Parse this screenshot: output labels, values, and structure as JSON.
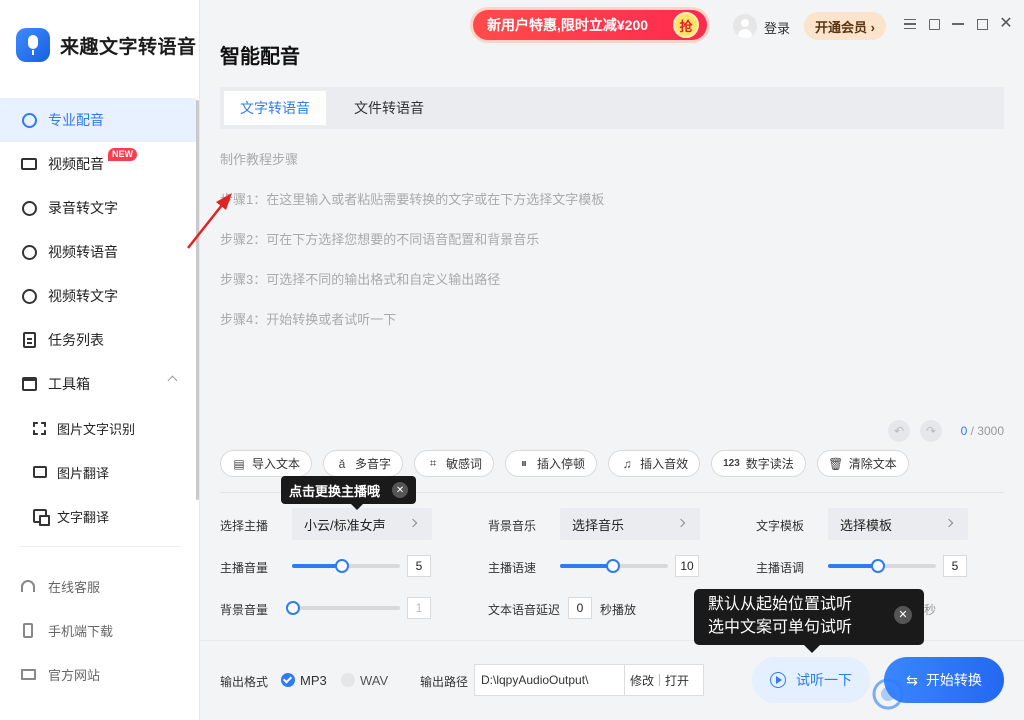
{
  "app": {
    "name": "来趣文字转语音"
  },
  "sidebar": {
    "items": [
      {
        "label": "专业配音",
        "icon": "waveform-icon",
        "active": true
      },
      {
        "label": "视频配音",
        "icon": "video-icon",
        "badge": "NEW"
      },
      {
        "label": "录音转文字",
        "icon": "record-icon"
      },
      {
        "label": "视频转语音",
        "icon": "play-circle-icon"
      },
      {
        "label": "视频转文字",
        "icon": "text-circle-icon"
      },
      {
        "label": "任务列表",
        "icon": "task-list-icon"
      },
      {
        "label": "工具箱",
        "icon": "toolbox-icon",
        "expanded": true
      }
    ],
    "tools": [
      {
        "label": "图片文字识别",
        "icon": "scan-icon"
      },
      {
        "label": "图片翻译",
        "icon": "image-icon"
      },
      {
        "label": "文字翻译",
        "icon": "translate-icon"
      }
    ],
    "bottom": [
      {
        "label": "在线客服",
        "icon": "headset-icon"
      },
      {
        "label": "手机端下载",
        "icon": "phone-icon"
      },
      {
        "label": "官方网站",
        "icon": "monitor-icon"
      }
    ]
  },
  "topbar": {
    "promo": "新用户特惠,限时立减¥200",
    "promo_grab": "抢",
    "login": "登录",
    "vip": "开通会员 ›"
  },
  "main": {
    "title": "智能配音",
    "tabs": [
      {
        "label": "文字转语音",
        "active": true
      },
      {
        "label": "文件转语音",
        "active": false
      }
    ],
    "placeholder": [
      "制作教程步骤",
      "步骤1：在这里输入或者粘贴需要转换的文字或在下方选择文字模板",
      "步骤2：可在下方选择您想要的不同语音配置和背景音乐",
      "步骤3：可选择不同的输出格式和自定义输出路径",
      "步骤4：开始转换或者试听一下"
    ],
    "counter_current": "0",
    "counter_total": " / 3000"
  },
  "toolbar": [
    {
      "label": "导入文本",
      "icon": "import-icon",
      "glyph": "▤"
    },
    {
      "label": "多音字",
      "icon": "polyphone-icon",
      "glyph": "ǎ"
    },
    {
      "label": "敏感词",
      "icon": "sensitive-icon",
      "glyph": "⌗"
    },
    {
      "label": "插入停顿",
      "icon": "pause-icon",
      "glyph": "⏸"
    },
    {
      "label": "插入音效",
      "icon": "music-note-icon",
      "glyph": "♫"
    },
    {
      "label": "数字读法",
      "icon": "number-icon",
      "glyph": "123"
    },
    {
      "label": "清除文本",
      "icon": "trash-icon",
      "glyph": "🗑"
    }
  ],
  "tooltip_anchor": {
    "text": "点击更换主播哦"
  },
  "settings": {
    "anchor_label": "选择主播",
    "anchor_value": "小云/标准女声",
    "bgm_label": "背景音乐",
    "bgm_value": "选择音乐",
    "template_label": "文字模板",
    "template_value": "选择模板",
    "anchor_volume_label": "主播音量",
    "anchor_volume": "5",
    "anchor_volume_pct": 0.45,
    "speed_label": "主播语速",
    "speed": "10",
    "speed_pct": 0.48,
    "pitch_label": "主播语调",
    "pitch": "5",
    "pitch_pct": 0.45,
    "bg_volume_label": "背景音量",
    "bg_volume": "1",
    "bg_volume_pct": 0.0,
    "delay_label": "文本语音延迟",
    "delay_value": "0",
    "delay_unit": "秒播放",
    "tail_fragment": "秒"
  },
  "output": {
    "format_label": "输出格式",
    "format_mp3": "MP3",
    "format_wav": "WAV",
    "path_label": "输出路径",
    "path_value": "D:\\lqpyAudioOutput\\",
    "modify": "修改",
    "open": "打开"
  },
  "actions": {
    "listen": "试听一下",
    "convert": "开始转换"
  },
  "tooltip_listen": {
    "line1": "默认从起始位置试听",
    "line2": "选中文案可单句试听"
  },
  "colors": {
    "accent": "#2f7bf5",
    "promo": "#ff3b4e"
  }
}
